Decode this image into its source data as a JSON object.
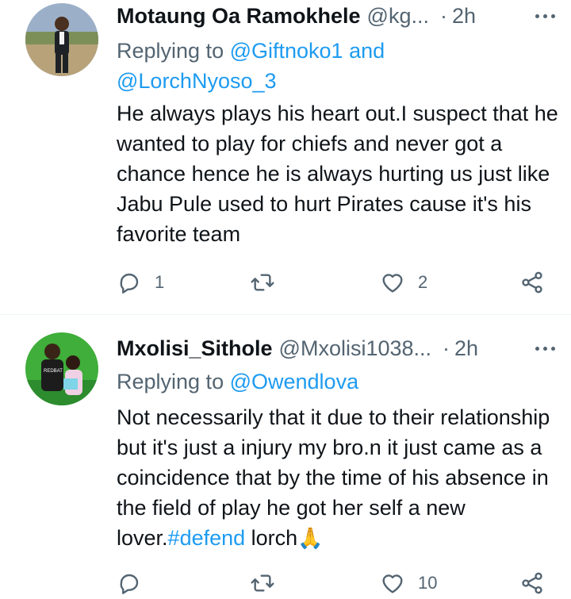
{
  "tweets": [
    {
      "name": "Motaung Oa Ramokhele",
      "handle": "@kg...",
      "dot": "·",
      "time": "2h",
      "replying_prefix": "Replying to ",
      "mention_1": "@Giftnoko1",
      "mention_joiner": " and",
      "mention_2": "@LorchNyoso_3",
      "text": "He always plays his heart out.I suspect that he wanted to play for chiefs and never got a chance hence he is always hurting us just like Jabu Pule used to hurt Pirates cause it's his favorite team",
      "replies": "1",
      "retweets": "",
      "likes": "2"
    },
    {
      "name": "Mxolisi_Sithole",
      "handle": "@Mxolisi1038...",
      "dot": "·",
      "time": "2h",
      "replying_prefix": "Replying to ",
      "mention_1": "@Owendlova",
      "text_before_hashtag": "Not necessarily that it due to their relationship but it's just a injury my bro.n it just came as a coincidence that by the time of his absence in the field of play he got her self a new lover.",
      "hashtag": "#defend",
      "text_after_hashtag": " lorch",
      "emoji": "🙏",
      "avatar_shirt_text": "REDBAT",
      "replies": "",
      "retweets": "",
      "likes": "10"
    }
  ],
  "icons": {
    "reply": "reply-icon",
    "retweet": "retweet-icon",
    "like": "heart-icon",
    "share": "share-icon",
    "more": "more-icon"
  },
  "colors": {
    "text": "#0f1419",
    "secondary": "#536471",
    "link": "#1d9bf0",
    "divider": "#eff3f4"
  }
}
